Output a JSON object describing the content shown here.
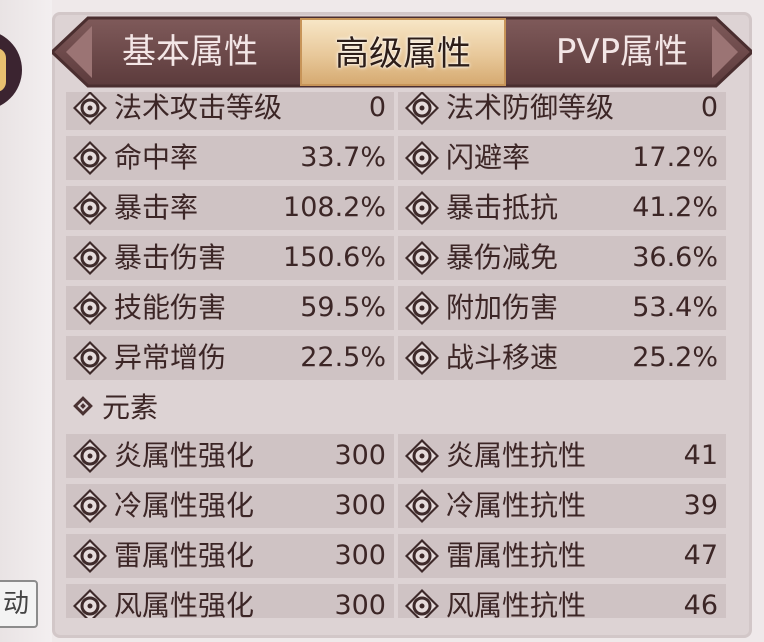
{
  "tabs": {
    "basic": "基本属性",
    "advanced": "高级属性",
    "pvp": "PVP属性"
  },
  "side_button": "动",
  "colors": {
    "tab_bar": "#6f4c4c",
    "active_tab": "#e8c89a",
    "row_bg": "#cfc3c4",
    "panel_bg": "#ddd3d4",
    "text": "#3c2626"
  },
  "rows": [
    {
      "left": {
        "icon": "magic-attack-icon",
        "label": "法术攻击等级",
        "value": "0"
      },
      "right": {
        "icon": "magic-defense-icon",
        "label": "法术防御等级",
        "value": "0"
      }
    },
    {
      "left": {
        "icon": "hit-rate-icon",
        "label": "命中率",
        "value": "33.7%"
      },
      "right": {
        "icon": "dodge-rate-icon",
        "label": "闪避率",
        "value": "17.2%"
      }
    },
    {
      "left": {
        "icon": "crit-rate-icon",
        "label": "暴击率",
        "value": "108.2%"
      },
      "right": {
        "icon": "crit-resist-icon",
        "label": "暴击抵抗",
        "value": "41.2%"
      }
    },
    {
      "left": {
        "icon": "crit-damage-icon",
        "label": "暴击伤害",
        "value": "150.6%"
      },
      "right": {
        "icon": "crit-damage-reduction-icon",
        "label": "暴伤减免",
        "value": "36.6%"
      }
    },
    {
      "left": {
        "icon": "skill-damage-icon",
        "label": "技能伤害",
        "value": "59.5%"
      },
      "right": {
        "icon": "bonus-damage-icon",
        "label": "附加伤害",
        "value": "53.4%"
      }
    },
    {
      "left": {
        "icon": "status-damage-icon",
        "label": "异常增伤",
        "value": "22.5%"
      },
      "right": {
        "icon": "combat-speed-icon",
        "label": "战斗移速",
        "value": "25.2%"
      }
    }
  ],
  "element_section": {
    "title": "元素"
  },
  "element_rows": [
    {
      "left": {
        "icon": "fire-boost-icon",
        "label": "炎属性强化",
        "value": "300"
      },
      "right": {
        "icon": "fire-resist-icon",
        "label": "炎属性抗性",
        "value": "41"
      }
    },
    {
      "left": {
        "icon": "ice-boost-icon",
        "label": "冷属性强化",
        "value": "300"
      },
      "right": {
        "icon": "ice-resist-icon",
        "label": "冷属性抗性",
        "value": "39"
      }
    },
    {
      "left": {
        "icon": "thunder-boost-icon",
        "label": "雷属性强化",
        "value": "300"
      },
      "right": {
        "icon": "thunder-resist-icon",
        "label": "雷属性抗性",
        "value": "47"
      }
    },
    {
      "left": {
        "icon": "wind-boost-icon",
        "label": "风属性强化",
        "value": "300"
      },
      "right": {
        "icon": "wind-resist-icon",
        "label": "风属性抗性",
        "value": "46"
      }
    }
  ]
}
